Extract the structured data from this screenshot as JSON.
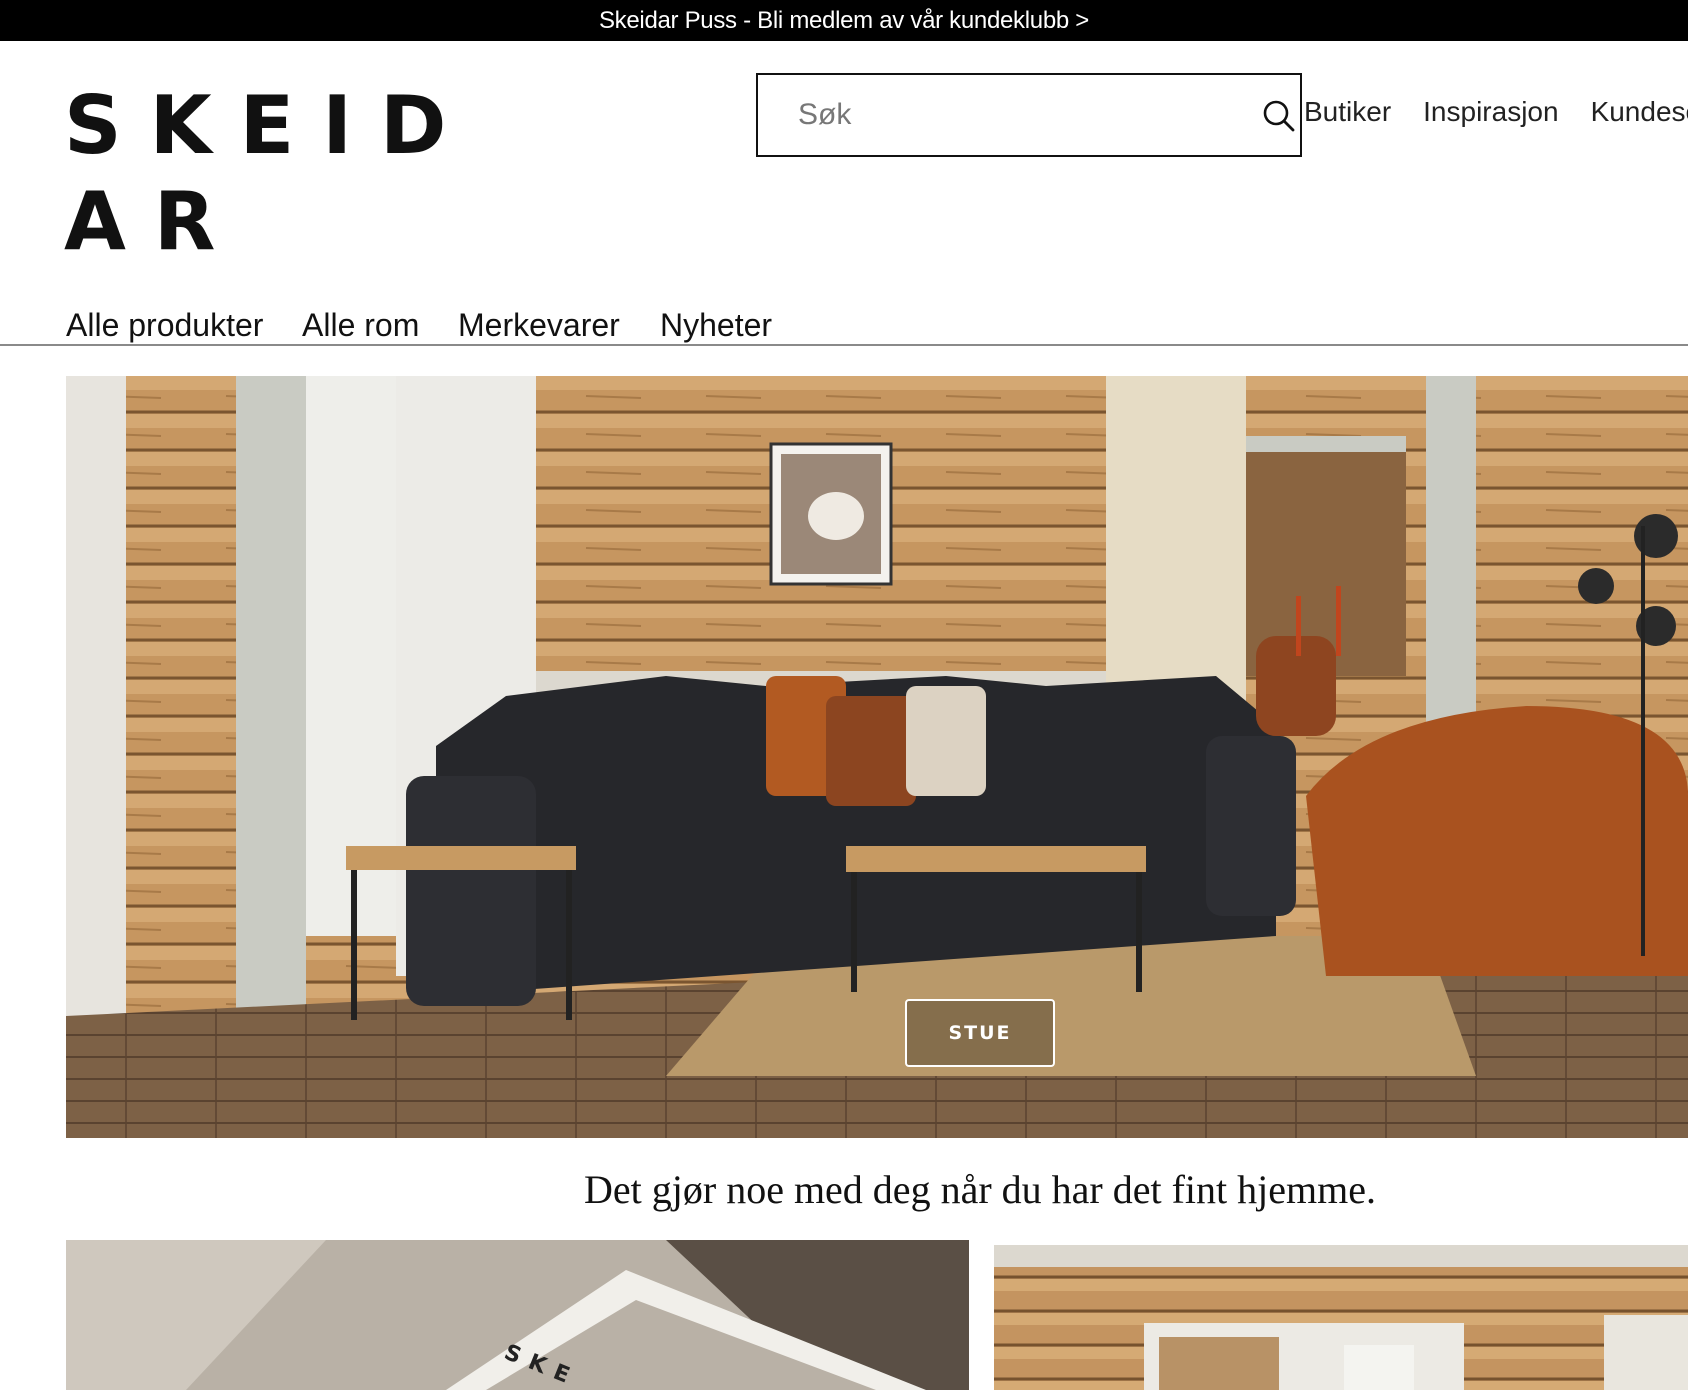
{
  "announcement": {
    "text": "Skeidar Puss - Bli medlem av vår kundeklubb >"
  },
  "brand": {
    "logo_text": "SKEIDAR"
  },
  "search": {
    "placeholder": "Søk"
  },
  "top_links": [
    "Butiker",
    "Inspirasjon",
    "Kundeservice"
  ],
  "main_nav": [
    "Alle produkter",
    "Alle rom",
    "Merkevarer",
    "Nyheter"
  ],
  "hero": {
    "button_label": "STUE"
  },
  "tagline": "Det gjør noe med deg når du har det fint hjemme.",
  "promo_cards": {
    "left_magazine_text": "SKE"
  },
  "icons": {
    "search": "search-icon"
  },
  "colors": {
    "topbar_bg": "#000000",
    "text": "#111111",
    "divider": "#8a8a8a"
  }
}
